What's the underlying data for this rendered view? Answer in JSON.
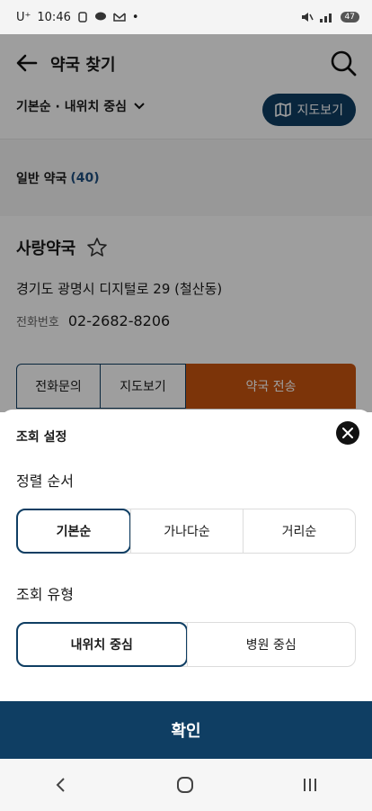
{
  "status_bar": {
    "carrier": "U⁺",
    "time": "10:46",
    "dot": "•",
    "battery": "47"
  },
  "header": {
    "title": "약국 찾기",
    "sort_label": "기본순 · 내위치 중심",
    "map_button_label": "지도보기"
  },
  "section": {
    "label": "일반 약국",
    "count": "(40)"
  },
  "card": {
    "name": "사랑약국",
    "address": "경기도 광명시 디지털로 29 (철산동)",
    "phone_label": "전화번호",
    "phone": "02-2682-8206",
    "actions": {
      "call": "전화문의",
      "map": "지도보기",
      "send": "약국 전송"
    }
  },
  "sheet": {
    "title": "조회 설정",
    "sort_order": {
      "label": "정렬 순서",
      "options": [
        "기본순",
        "가나다순",
        "거리순"
      ],
      "selected": "기본순"
    },
    "search_type": {
      "label": "조회 유형",
      "options": [
        "내위치 중심",
        "병원 중심"
      ],
      "selected": "내위치 중심"
    },
    "confirm_label": "확인"
  },
  "colors": {
    "primary": "#0f3e63",
    "accent": "#c95510"
  }
}
